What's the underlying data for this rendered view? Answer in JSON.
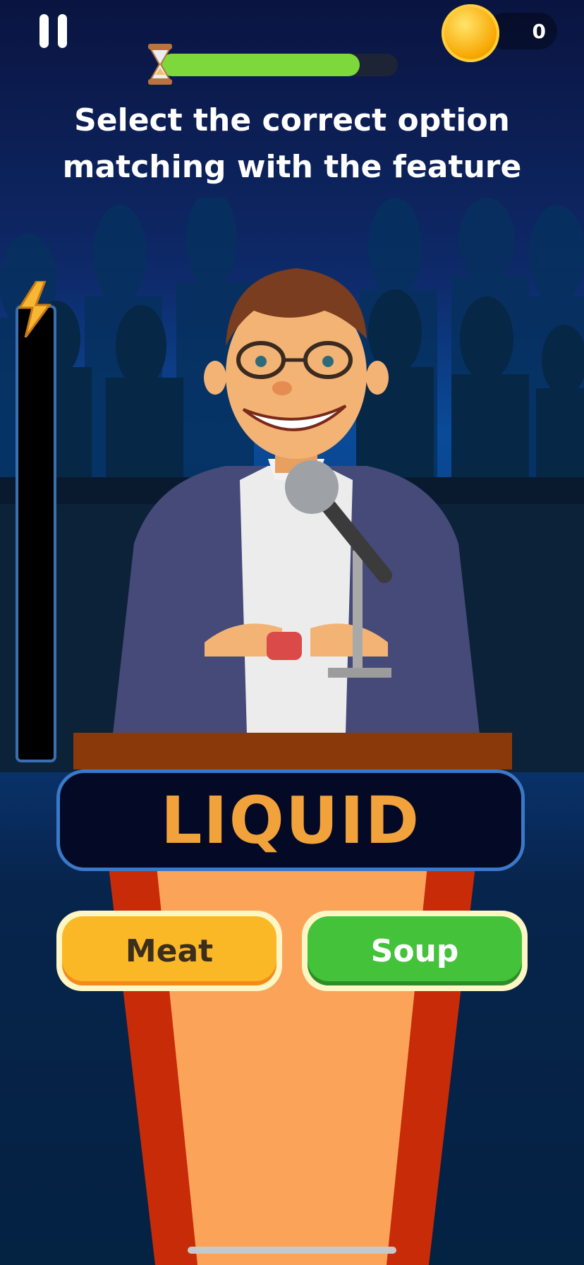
{
  "hud": {
    "coins": "0",
    "timer_progress": 0.84
  },
  "prompt": {
    "line1": "Select the correct option",
    "line2": "matching with the feature"
  },
  "question": {
    "word": "LIQUID"
  },
  "options": [
    {
      "label": "Meat",
      "color": "#fbb826"
    },
    {
      "label": "Soup",
      "color": "#43c23a"
    }
  ],
  "icons": [
    "pause-icon",
    "coin-icon",
    "hourglass-icon",
    "lightning-icon"
  ]
}
